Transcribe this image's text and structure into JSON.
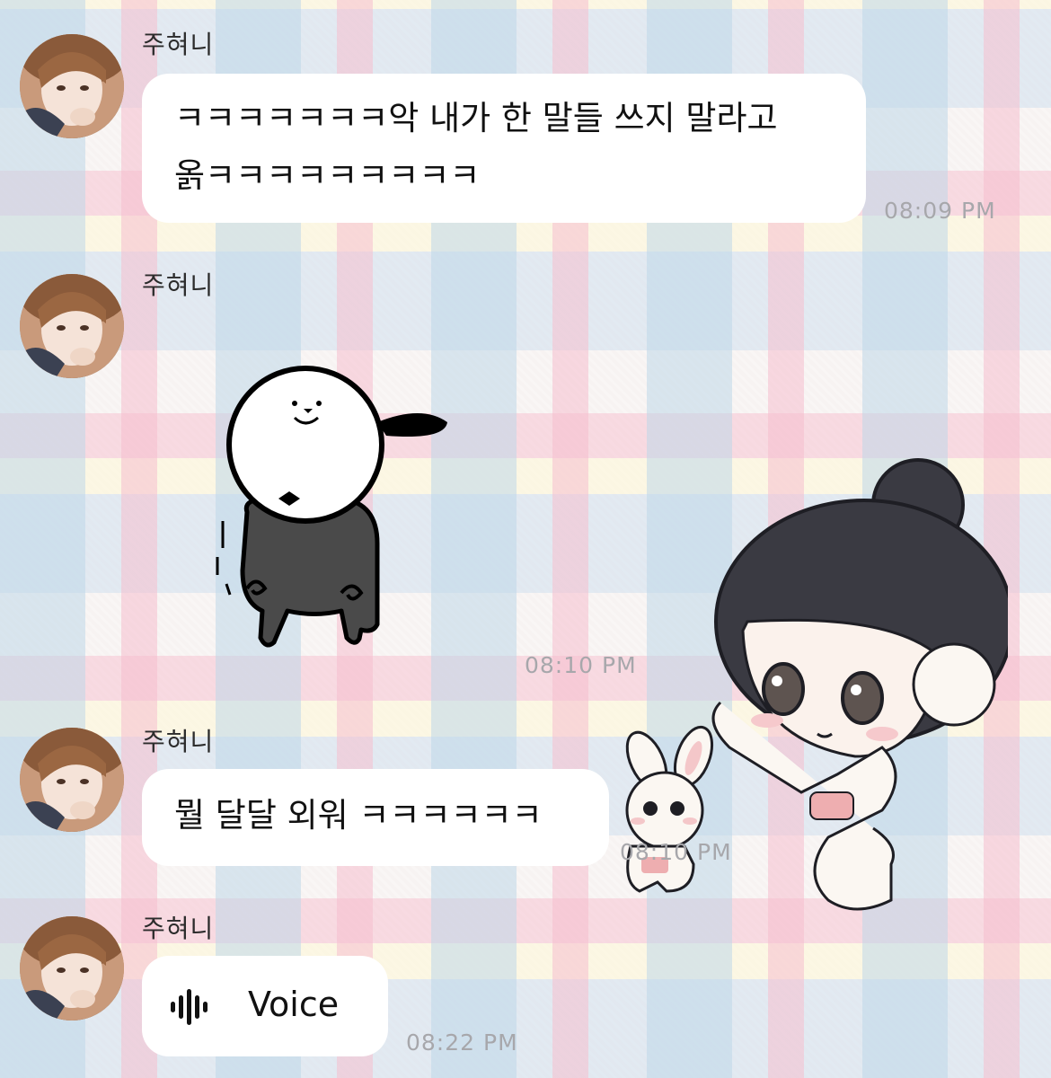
{
  "messages": [
    {
      "sender": "주혀니",
      "lines": [
        "ㅋㅋㅋㅋㅋㅋㅋ악 내가 한 말들 쓰지 말라고",
        "옭ㅋㅋㅋㅋㅋㅋㅋㅋㅋ"
      ],
      "time": "08:09 PM"
    },
    {
      "sender": "주혀니",
      "sticker": "white-dog-sticker",
      "time": "08:10 PM"
    },
    {
      "sender": "주혀니",
      "lines": [
        "뭘 달달 외워 ㅋㅋㅋㅋㅋㅋ"
      ],
      "time": "08:10 PM"
    },
    {
      "sender": "주혀니",
      "voice_label": "Voice",
      "time": "08:22 PM"
    }
  ],
  "overlay_sticker": "chibi-girl-with-bunny-sticker",
  "colors": {
    "bubble": "#ffffff",
    "timestamp": "#a7a7ab",
    "text": "#111111"
  }
}
